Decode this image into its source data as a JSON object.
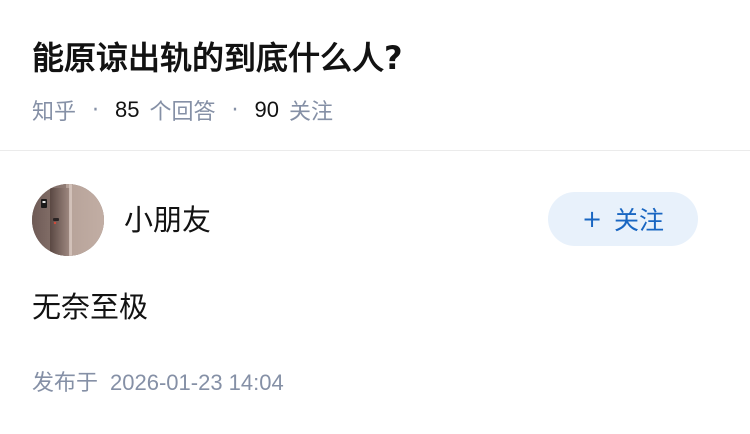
{
  "question": {
    "title": "能原谅出轨的到底什么人?",
    "source": "知乎",
    "separator": "·",
    "answer_count": "85",
    "answer_count_label": "个回答",
    "follower_count": "90",
    "follower_count_label": "关注"
  },
  "answer": {
    "author": {
      "name": "小朋友",
      "avatar_icon": "avatar-photo"
    },
    "follow_button": {
      "icon": "+",
      "label": "关注"
    },
    "content": "无奈至极",
    "published_label": "发布于",
    "published_time": "2026-01-23 14:04"
  },
  "colors": {
    "text_primary": "#121212",
    "text_secondary": "#8590a6",
    "follow_bg": "#e8f1fb",
    "follow_text": "#1966c2",
    "divider": "#ebebeb"
  }
}
